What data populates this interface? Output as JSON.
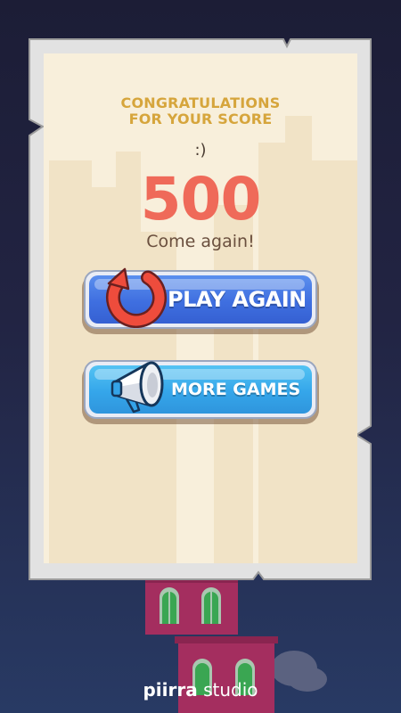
{
  "dialog": {
    "title_line1": "CONGRATULATIONS",
    "title_line2": "FOR YOUR SCORE",
    "emoticon": ":)",
    "score": "500",
    "message": "Come again!"
  },
  "buttons": {
    "play_again": {
      "label": "PLAY AGAIN",
      "icon": "restart-icon"
    },
    "more_games": {
      "label": "MORE GAMES",
      "icon": "megaphone-icon"
    }
  },
  "branding": {
    "brand": "piirra",
    "suffix": "studio"
  },
  "colors": {
    "background": "#222443",
    "panel": "#f8efdb",
    "panel_border": "#d0d0d0",
    "title": "#d6a53c",
    "score": "#ef6a59",
    "play_button": "#4276e3",
    "more_button": "#3aaaea",
    "tower": "#a42e5f"
  }
}
